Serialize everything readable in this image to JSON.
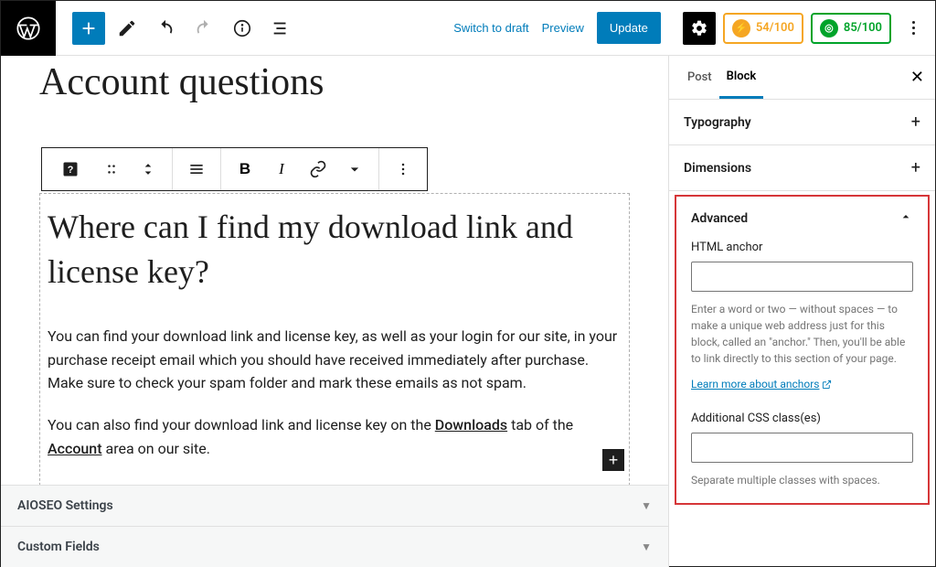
{
  "topbar": {
    "switch_draft": "Switch to draft",
    "preview": "Preview",
    "update": "Update",
    "seo1": "54/100",
    "seo2": "85/100"
  },
  "editor": {
    "page_title": "Account questions",
    "heading": "Where can I find my download link and license key?",
    "para1_a": "You can find your download link and license key, as well as your login for our site, in your purchase receipt email which you should have received immediately after purchase. Make sure to check your spam folder and mark these emails as not spam.",
    "para2_a": "You can also find your download link and license key on the ",
    "para2_link1": "Downloads",
    "para2_b": " tab of the ",
    "para2_link2": "Account",
    "para2_c": " area on our site."
  },
  "panels": {
    "aioseo": "AIOSEO Settings",
    "custom": "Custom Fields"
  },
  "sidebar": {
    "tab_post": "Post",
    "tab_block": "Block",
    "sec_typography": "Typography",
    "sec_dimensions": "Dimensions",
    "sec_advanced": "Advanced",
    "anchor_label": "HTML anchor",
    "anchor_help": "Enter a word or two — without spaces — to make a unique web address just for this block, called an \"anchor.\" Then, you'll be able to link directly to this section of your page.",
    "anchor_link": "Learn more about anchors",
    "css_label": "Additional CSS class(es)",
    "css_help": "Separate multiple classes with spaces."
  }
}
